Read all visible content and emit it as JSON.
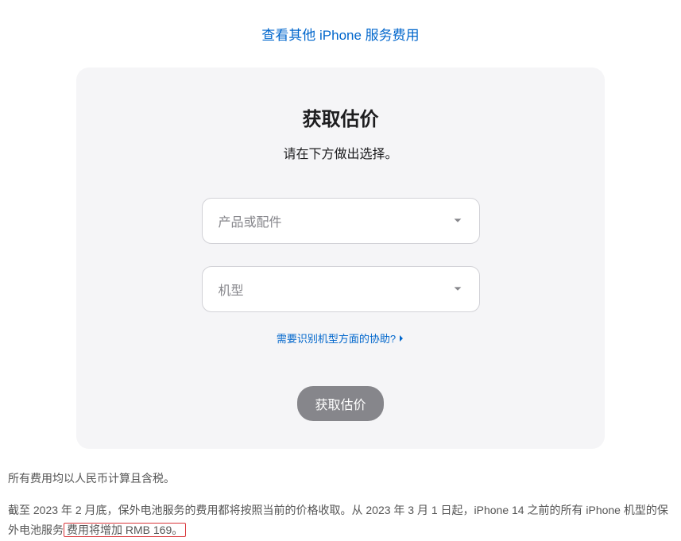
{
  "topLink": "查看其他 iPhone 服务费用",
  "card": {
    "title": "获取估价",
    "subtitle": "请在下方做出选择。",
    "select1": "产品或配件",
    "select2": "机型",
    "helpLink": "需要识别机型方面的协助?",
    "submit": "获取估价"
  },
  "footer": {
    "line1": "所有费用均以人民币计算且含税。",
    "line2a": "截至 2023 年 2 月底，保外电池服务的费用都将按照当前的价格收取。从 2023 年 3 月 1 日起，iPhone 14 之前的所有 iPhone 机型的保外电池服务",
    "line2b": "费用将增加 RMB 169。"
  }
}
